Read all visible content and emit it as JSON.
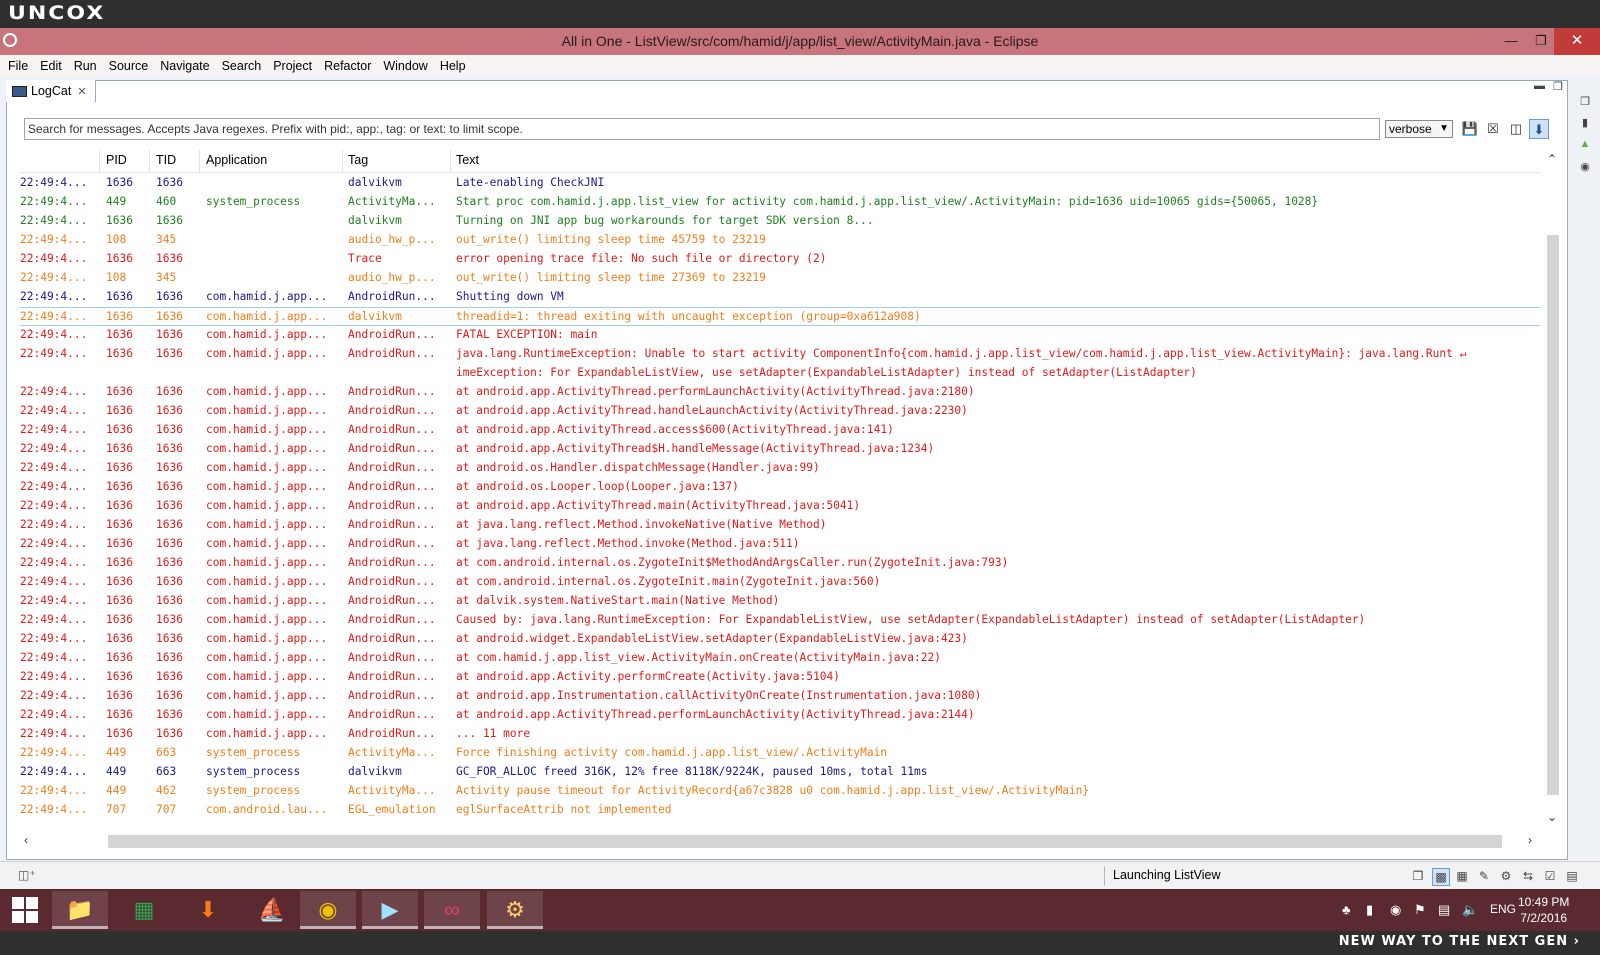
{
  "brand": "UNCOX",
  "window": {
    "title": "All in One - ListView/src/com/hamid/j/app/list_view/ActivityMain.java - Eclipse"
  },
  "menu": [
    "File",
    "Edit",
    "Run",
    "Source",
    "Navigate",
    "Search",
    "Project",
    "Refactor",
    "Window",
    "Help"
  ],
  "view": {
    "tab_label": "LogCat"
  },
  "search": {
    "placeholder": "Search for messages. Accepts Java regexes. Prefix with pid:, app:, tag: or text: to limit scope.",
    "level": "verbose"
  },
  "columns": {
    "time": "",
    "pid": "PID",
    "tid": "TID",
    "app": "Application",
    "tag": "Tag",
    "text": "Text"
  },
  "colors": {
    "debug": "#1a1a8a",
    "info": "#208020",
    "warn": "#f07e1a",
    "error": "#e01a1a"
  },
  "rows": [
    {
      "level": "D",
      "time": "22:49:4...",
      "pid": "1636",
      "tid": "1636",
      "app": "",
      "tag": "dalvikvm",
      "text": "Late-enabling CheckJNI"
    },
    {
      "level": "I",
      "time": "22:49:4...",
      "pid": "449",
      "tid": "460",
      "app": "system_process",
      "tag": "ActivityMa...",
      "text": "Start proc com.hamid.j.app.list_view for activity com.hamid.j.app.list_view/.ActivityMain: pid=1636 uid=10065 gids={50065, 1028}"
    },
    {
      "level": "I",
      "time": "22:49:4...",
      "pid": "1636",
      "tid": "1636",
      "app": "",
      "tag": "dalvikvm",
      "text": "Turning on JNI app bug workarounds for target SDK version 8..."
    },
    {
      "level": "W",
      "time": "22:49:4...",
      "pid": "108",
      "tid": "345",
      "app": "",
      "tag": "audio_hw_p...",
      "text": "out_write() limiting sleep time 45759 to 23219"
    },
    {
      "level": "E",
      "time": "22:49:4...",
      "pid": "1636",
      "tid": "1636",
      "app": "",
      "tag": "Trace",
      "text": "error opening trace file: No such file or directory (2)"
    },
    {
      "level": "W",
      "time": "22:49:4...",
      "pid": "108",
      "tid": "345",
      "app": "",
      "tag": "audio_hw_p...",
      "text": "out_write() limiting sleep time 27369 to 23219"
    },
    {
      "level": "D",
      "time": "22:49:4...",
      "pid": "1636",
      "tid": "1636",
      "app": "com.hamid.j.app...",
      "tag": "AndroidRun...",
      "text": "Shutting down VM"
    },
    {
      "level": "W",
      "time": "22:49:4...",
      "pid": "1636",
      "tid": "1636",
      "app": "com.hamid.j.app...",
      "tag": "dalvikvm",
      "text": "threadid=1: thread exiting with uncaught exception (group=0xa612a908)",
      "selected": true
    },
    {
      "level": "E",
      "time": "22:49:4...",
      "pid": "1636",
      "tid": "1636",
      "app": "com.hamid.j.app...",
      "tag": "AndroidRun...",
      "text": "FATAL EXCEPTION: main"
    },
    {
      "level": "E",
      "time": "22:49:4...",
      "pid": "1636",
      "tid": "1636",
      "app": "com.hamid.j.app...",
      "tag": "AndroidRun...",
      "text": "java.lang.RuntimeException: Unable to start activity ComponentInfo{com.hamid.j.app.list_view/com.hamid.j.app.list_view.ActivityMain}: java.lang.Runt ↵"
    },
    {
      "level": "E",
      "time": "",
      "pid": "",
      "tid": "",
      "app": "",
      "tag": "",
      "text": "imeException: For ExpandableListView, use setAdapter(ExpandableListAdapter) instead of setAdapter(ListAdapter)"
    },
    {
      "level": "E",
      "time": "22:49:4...",
      "pid": "1636",
      "tid": "1636",
      "app": "com.hamid.j.app...",
      "tag": "AndroidRun...",
      "text": "at android.app.ActivityThread.performLaunchActivity(ActivityThread.java:2180)"
    },
    {
      "level": "E",
      "time": "22:49:4...",
      "pid": "1636",
      "tid": "1636",
      "app": "com.hamid.j.app...",
      "tag": "AndroidRun...",
      "text": "at android.app.ActivityThread.handleLaunchActivity(ActivityThread.java:2230)"
    },
    {
      "level": "E",
      "time": "22:49:4...",
      "pid": "1636",
      "tid": "1636",
      "app": "com.hamid.j.app...",
      "tag": "AndroidRun...",
      "text": "at android.app.ActivityThread.access$600(ActivityThread.java:141)"
    },
    {
      "level": "E",
      "time": "22:49:4...",
      "pid": "1636",
      "tid": "1636",
      "app": "com.hamid.j.app...",
      "tag": "AndroidRun...",
      "text": "at android.app.ActivityThread$H.handleMessage(ActivityThread.java:1234)"
    },
    {
      "level": "E",
      "time": "22:49:4...",
      "pid": "1636",
      "tid": "1636",
      "app": "com.hamid.j.app...",
      "tag": "AndroidRun...",
      "text": "at android.os.Handler.dispatchMessage(Handler.java:99)"
    },
    {
      "level": "E",
      "time": "22:49:4...",
      "pid": "1636",
      "tid": "1636",
      "app": "com.hamid.j.app...",
      "tag": "AndroidRun...",
      "text": "at android.os.Looper.loop(Looper.java:137)"
    },
    {
      "level": "E",
      "time": "22:49:4...",
      "pid": "1636",
      "tid": "1636",
      "app": "com.hamid.j.app...",
      "tag": "AndroidRun...",
      "text": "at android.app.ActivityThread.main(ActivityThread.java:5041)"
    },
    {
      "level": "E",
      "time": "22:49:4...",
      "pid": "1636",
      "tid": "1636",
      "app": "com.hamid.j.app...",
      "tag": "AndroidRun...",
      "text": "at java.lang.reflect.Method.invokeNative(Native Method)"
    },
    {
      "level": "E",
      "time": "22:49:4...",
      "pid": "1636",
      "tid": "1636",
      "app": "com.hamid.j.app...",
      "tag": "AndroidRun...",
      "text": "at java.lang.reflect.Method.invoke(Method.java:511)"
    },
    {
      "level": "E",
      "time": "22:49:4...",
      "pid": "1636",
      "tid": "1636",
      "app": "com.hamid.j.app...",
      "tag": "AndroidRun...",
      "text": "at com.android.internal.os.ZygoteInit$MethodAndArgsCaller.run(ZygoteInit.java:793)"
    },
    {
      "level": "E",
      "time": "22:49:4...",
      "pid": "1636",
      "tid": "1636",
      "app": "com.hamid.j.app...",
      "tag": "AndroidRun...",
      "text": "at com.android.internal.os.ZygoteInit.main(ZygoteInit.java:560)"
    },
    {
      "level": "E",
      "time": "22:49:4...",
      "pid": "1636",
      "tid": "1636",
      "app": "com.hamid.j.app...",
      "tag": "AndroidRun...",
      "text": "at dalvik.system.NativeStart.main(Native Method)"
    },
    {
      "level": "E",
      "time": "22:49:4...",
      "pid": "1636",
      "tid": "1636",
      "app": "com.hamid.j.app...",
      "tag": "AndroidRun...",
      "text": "Caused by: java.lang.RuntimeException: For ExpandableListView, use setAdapter(ExpandableListAdapter) instead of setAdapter(ListAdapter)"
    },
    {
      "level": "E",
      "time": "22:49:4...",
      "pid": "1636",
      "tid": "1636",
      "app": "com.hamid.j.app...",
      "tag": "AndroidRun...",
      "text": "at android.widget.ExpandableListView.setAdapter(ExpandableListView.java:423)"
    },
    {
      "level": "E",
      "time": "22:49:4...",
      "pid": "1636",
      "tid": "1636",
      "app": "com.hamid.j.app...",
      "tag": "AndroidRun...",
      "text": "at com.hamid.j.app.list_view.ActivityMain.onCreate(ActivityMain.java:22)"
    },
    {
      "level": "E",
      "time": "22:49:4...",
      "pid": "1636",
      "tid": "1636",
      "app": "com.hamid.j.app...",
      "tag": "AndroidRun...",
      "text": "at android.app.Activity.performCreate(Activity.java:5104)"
    },
    {
      "level": "E",
      "time": "22:49:4...",
      "pid": "1636",
      "tid": "1636",
      "app": "com.hamid.j.app...",
      "tag": "AndroidRun...",
      "text": "at android.app.Instrumentation.callActivityOnCreate(Instrumentation.java:1080)"
    },
    {
      "level": "E",
      "time": "22:49:4...",
      "pid": "1636",
      "tid": "1636",
      "app": "com.hamid.j.app...",
      "tag": "AndroidRun...",
      "text": "at android.app.ActivityThread.performLaunchActivity(ActivityThread.java:2144)"
    },
    {
      "level": "E",
      "time": "22:49:4...",
      "pid": "1636",
      "tid": "1636",
      "app": "com.hamid.j.app...",
      "tag": "AndroidRun...",
      "text": "... 11 more"
    },
    {
      "level": "W",
      "time": "22:49:4...",
      "pid": "449",
      "tid": "663",
      "app": "system_process",
      "tag": "ActivityMa...",
      "text": "  Force finishing activity com.hamid.j.app.list_view/.ActivityMain"
    },
    {
      "level": "D",
      "time": "22:49:4...",
      "pid": "449",
      "tid": "663",
      "app": "system_process",
      "tag": "dalvikvm",
      "text": "GC_FOR_ALLOC freed 316K, 12% free 8118K/9224K, paused 10ms, total 11ms"
    },
    {
      "level": "W",
      "time": "22:49:4...",
      "pid": "449",
      "tid": "462",
      "app": "system_process",
      "tag": "ActivityMa...",
      "text": "Activity pause timeout for ActivityRecord{a67c3828 u0 com.hamid.j.app.list_view/.ActivityMain}"
    },
    {
      "level": "W",
      "time": "22:49:4...",
      "pid": "707",
      "tid": "707",
      "app": "com.android.lau...",
      "tag": "EGL_emulation",
      "text": "eglSurfaceAttrib not implemented"
    }
  ],
  "status": {
    "text": "Launching ListView"
  },
  "taskbar": {
    "lang": "ENG",
    "time": "10:49 PM",
    "date": "7/2/2016"
  },
  "slogan": "NEW WAY TO THE NEXT GEN ›"
}
